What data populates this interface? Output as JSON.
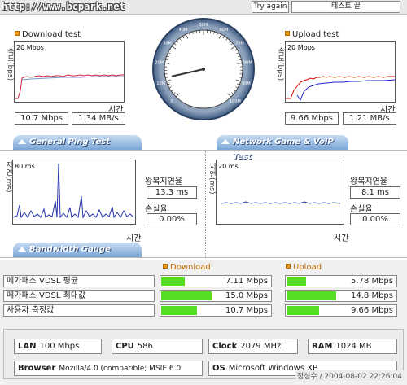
{
  "header": {
    "url": "http://www.bcpark.net",
    "try_again": "Try again",
    "test_name": "테스트 끝"
  },
  "download": {
    "title": "Download test",
    "scale": "20 Mbps",
    "ylabel": "속도(bps)",
    "xlabel": "시간",
    "mbps": "10.7 Mbps",
    "mbs": "1.34 MB/s"
  },
  "upload": {
    "title": "Upload test",
    "scale": "20 Mbps",
    "ylabel": "속도(bps)",
    "xlabel": "시간",
    "mbps": "9.66 Mbps",
    "mbs": "1.21 MB/s"
  },
  "gauge": {
    "ticks": [
      "0",
      "10M",
      "20M",
      "30M",
      "40M",
      "50M",
      "60M",
      "70M",
      "80M",
      "90M",
      "100M"
    ],
    "needle_fraction": 0.12
  },
  "tabs": {
    "ping": "General Ping Test",
    "game": "Network Game & VoIP Test",
    "bandwidth": "Bandwidth Gauge"
  },
  "ping": {
    "scale": "80 ms",
    "ylabel": "지연(ms)",
    "xlabel": "시간",
    "rtt_label": "왕복지연율",
    "rtt": "13.3 ms",
    "loss_label": "손실율",
    "loss": "0.00%"
  },
  "game": {
    "scale": "20 ms",
    "ylabel": "지연(ms)",
    "xlabel": "시간",
    "rtt_label": "왕복지연율",
    "rtt": "8.1 ms",
    "loss_label": "손실율",
    "loss": "0.00%"
  },
  "bandwidth": {
    "download_label": "Download",
    "upload_label": "Upload",
    "rows": [
      {
        "label": "메가패스 VDSL 평균",
        "down": "7.11 Mbps",
        "down_frac": 0.47,
        "up": "5.78 Mbps",
        "up_frac": 0.39
      },
      {
        "label": "메가패스 VDSL 최대값",
        "down": "15.0 Mbps",
        "down_frac": 1.0,
        "up": "14.8 Mbps",
        "up_frac": 0.99
      },
      {
        "label": "사용자 측정값",
        "down": "10.7 Mbps",
        "down_frac": 0.71,
        "up": "9.66 Mbps",
        "up_frac": 0.64
      }
    ]
  },
  "info": {
    "lan_label": "LAN",
    "lan": "100 Mbps",
    "cpu_label": "CPU",
    "cpu": "586",
    "clock_label": "Clock",
    "clock": "2079 MHz",
    "ram_label": "RAM",
    "ram": "1024 MB",
    "browser_label": "Browser",
    "browser": "Mozilla/4.0 (compatible; MSIE 6.0",
    "os_label": "OS",
    "os": "Microsoft Windows XP",
    "footer": "정성수 / 2004-08-02 22:26:04"
  },
  "colors": {
    "download_line": "#cc2244",
    "upload_red": "#dd0000",
    "upload_blue": "#2222cc",
    "ping_line": "#2233aa",
    "bar_green": "#55dd22",
    "tab_blue": "#7aa5d6",
    "accent_orange": "#e89a1c"
  }
}
